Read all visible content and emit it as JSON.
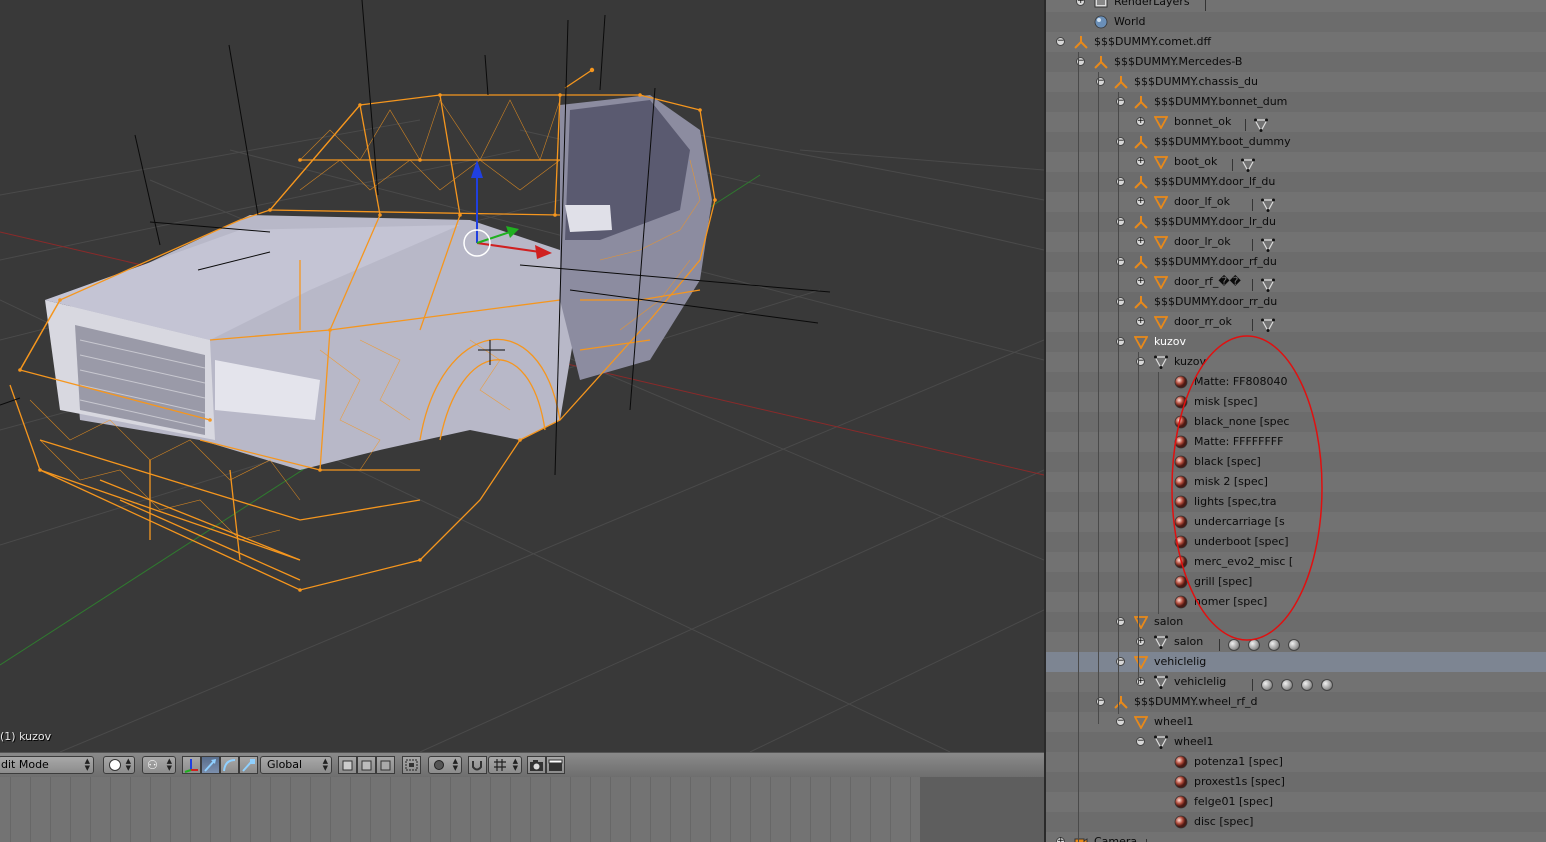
{
  "viewport": {
    "status": "(1) kuzov"
  },
  "toolbar": {
    "mode": "dit Mode",
    "orientation": "Global"
  },
  "outliner": {
    "rows": [
      {
        "label": "RenderLayers",
        "depth": 1,
        "icon": "renderlayers-icon",
        "exp": "+",
        "extras": "sep-only"
      },
      {
        "label": "World",
        "depth": 1,
        "icon": "world-icon",
        "exp": ""
      },
      {
        "label": "$$$DUMMY.comet.dff",
        "depth": 0,
        "icon": "empty-icon",
        "exp": "-"
      },
      {
        "label": "$$$DUMMY.Mercedes-B",
        "depth": 1,
        "icon": "empty-icon",
        "exp": "-"
      },
      {
        "label": "$$$DUMMY.chassis_du",
        "depth": 2,
        "icon": "empty-icon",
        "exp": "-"
      },
      {
        "label": "$$$DUMMY.bonnet_dum",
        "depth": 3,
        "icon": "empty-icon",
        "exp": "-"
      },
      {
        "label": "bonnet_ok",
        "depth": 4,
        "icon": "mesh-object-icon",
        "exp": "+",
        "extras": "mesh"
      },
      {
        "label": "$$$DUMMY.boot_dummy",
        "depth": 3,
        "icon": "empty-icon",
        "exp": "-"
      },
      {
        "label": "boot_ok",
        "depth": 4,
        "icon": "mesh-object-icon",
        "exp": "+",
        "extras": "mesh"
      },
      {
        "label": "$$$DUMMY.door_lf_du",
        "depth": 3,
        "icon": "empty-icon",
        "exp": "-"
      },
      {
        "label": "door_lf_ok",
        "depth": 4,
        "icon": "mesh-object-icon",
        "exp": "+",
        "extras": "mesh"
      },
      {
        "label": "$$$DUMMY.door_lr_du",
        "depth": 3,
        "icon": "empty-icon",
        "exp": "-"
      },
      {
        "label": "door_lr_ok",
        "depth": 4,
        "icon": "mesh-object-icon",
        "exp": "+",
        "extras": "mesh"
      },
      {
        "label": "$$$DUMMY.door_rf_du",
        "depth": 3,
        "icon": "empty-icon",
        "exp": "-"
      },
      {
        "label": "door_rf_��",
        "depth": 4,
        "icon": "mesh-object-icon",
        "exp": "+",
        "extras": "mesh"
      },
      {
        "label": "$$$DUMMY.door_rr_du",
        "depth": 3,
        "icon": "empty-icon",
        "exp": "-"
      },
      {
        "label": "door_rr_ok",
        "depth": 4,
        "icon": "mesh-object-icon",
        "exp": "+",
        "extras": "mesh"
      },
      {
        "label": "kuzov",
        "depth": 3,
        "icon": "mesh-object-icon",
        "exp": "-",
        "white": true
      },
      {
        "label": "kuzov",
        "depth": 4,
        "icon": "mesh-data-icon",
        "exp": "-"
      },
      {
        "label": "Matte: FF808040",
        "depth": 5,
        "icon": "material-icon",
        "exp": ""
      },
      {
        "label": "misk [spec]",
        "depth": 5,
        "icon": "material-icon",
        "exp": ""
      },
      {
        "label": "black_none [spec",
        "depth": 5,
        "icon": "material-icon",
        "exp": ""
      },
      {
        "label": "Matte: FFFFFFFF",
        "depth": 5,
        "icon": "material-icon",
        "exp": ""
      },
      {
        "label": "black [spec]",
        "depth": 5,
        "icon": "material-icon",
        "exp": ""
      },
      {
        "label": "misk 2 [spec]",
        "depth": 5,
        "icon": "material-icon",
        "exp": ""
      },
      {
        "label": "lights [spec,tra",
        "depth": 5,
        "icon": "material-icon",
        "exp": ""
      },
      {
        "label": "undercarriage [s",
        "depth": 5,
        "icon": "material-icon",
        "exp": ""
      },
      {
        "label": "underboot [spec]",
        "depth": 5,
        "icon": "material-icon",
        "exp": ""
      },
      {
        "label": "merc_evo2_misc [",
        "depth": 5,
        "icon": "material-icon",
        "exp": ""
      },
      {
        "label": "grill [spec]",
        "depth": 5,
        "icon": "material-icon",
        "exp": ""
      },
      {
        "label": "nomer [spec]",
        "depth": 5,
        "icon": "material-icon",
        "exp": ""
      },
      {
        "label": "salon",
        "depth": 3,
        "icon": "mesh-object-icon",
        "exp": "-"
      },
      {
        "label": "salon",
        "depth": 4,
        "icon": "mesh-data-icon",
        "exp": "+",
        "extras": "mats4"
      },
      {
        "label": "vehiclelig",
        "depth": 3,
        "icon": "mesh-object-icon",
        "exp": "-",
        "highlight": true
      },
      {
        "label": "vehiclelig",
        "depth": 4,
        "icon": "mesh-data-icon",
        "exp": "+",
        "extras": "mats4"
      },
      {
        "label": "$$$DUMMY.wheel_rf_d",
        "depth": 2,
        "icon": "empty-icon",
        "exp": "-"
      },
      {
        "label": "wheel1",
        "depth": 3,
        "icon": "mesh-object-icon",
        "exp": "-"
      },
      {
        "label": "wheel1",
        "depth": 4,
        "icon": "mesh-data-icon",
        "exp": "-"
      },
      {
        "label": "potenza1 [spec]",
        "depth": 5,
        "icon": "material-icon",
        "exp": ""
      },
      {
        "label": "proxest1s [spec]",
        "depth": 5,
        "icon": "material-icon",
        "exp": ""
      },
      {
        "label": "felge01 [spec]",
        "depth": 5,
        "icon": "material-icon",
        "exp": ""
      },
      {
        "label": "disc [spec]",
        "depth": 5,
        "icon": "material-icon",
        "exp": ""
      },
      {
        "label": "Camera",
        "depth": 0,
        "icon": "camera-icon",
        "exp": "+",
        "extras": "sep-only"
      }
    ]
  },
  "colors": {
    "selection_orange": "#f5961e",
    "annotation_red": "#e01010",
    "axis_x": "#d02020",
    "axis_y": "#20b020",
    "axis_z": "#2040e0"
  }
}
